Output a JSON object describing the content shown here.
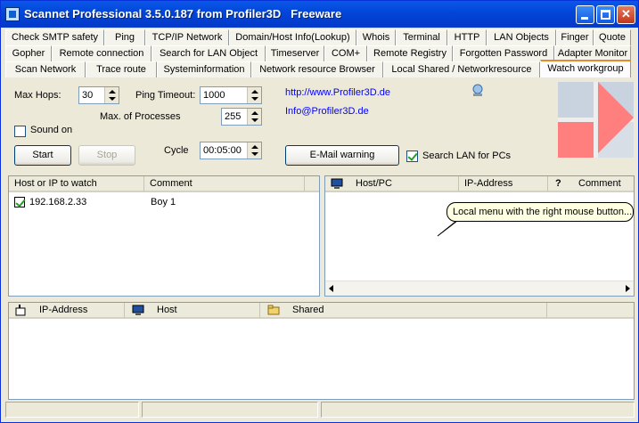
{
  "window": {
    "title": "Scannet Professional 3.5.0.187 from Profiler3D   Freeware"
  },
  "tabs": {
    "row1": [
      "Check SMTP safety",
      "Ping",
      "TCP/IP Network",
      "Domain/Host Info(Lookup)",
      "Whois",
      "Terminal",
      "HTTP",
      "LAN Objects",
      "Finger",
      "Quote"
    ],
    "row2": [
      "Gopher",
      "Remote connection",
      "Search for LAN Object",
      "Timeserver",
      "COM+",
      "Remote Registry",
      "Forgotten Password",
      "Adapter Monitor"
    ],
    "row3": [
      "Scan Network",
      "Trace route",
      "Systeminformation",
      "Network resource Browser",
      "Local Shared / Networkresource",
      "Watch workgroup"
    ],
    "active": "Watch workgroup"
  },
  "settings": {
    "max_hops_label": "Max Hops:",
    "max_hops_value": "30",
    "ping_timeout_label": "Ping Timeout:",
    "ping_timeout_value": "1000",
    "max_processes_label": "Max. of  Processes",
    "max_processes_value": "255",
    "sound_on_label": "Sound on",
    "sound_on_checked": false,
    "cycle_label": "Cycle",
    "cycle_value": "00:05:00",
    "start_label": "Start",
    "stop_label": "Stop",
    "email_warning_label": "E-Mail warning",
    "search_lan_label": "Search LAN for PCs",
    "search_lan_checked": true,
    "link_web": "http://www.Profiler3D.de",
    "link_mail": "Info@Profiler3D.de"
  },
  "watch_list": {
    "columns": [
      "Host or IP to watch",
      "Comment"
    ],
    "rows": [
      {
        "checked": true,
        "host": "192.168.2.33",
        "comment": "Boy 1"
      }
    ]
  },
  "host_list": {
    "columns": [
      "Host/PC",
      "IP-Address",
      "Comment"
    ],
    "tooltip": "Local menu with the right mouse button..."
  },
  "shares_list": {
    "columns": [
      "IP-Address",
      "Host",
      "Shared"
    ]
  },
  "colors": {
    "titlebar": "#0245D8",
    "tab_active_accent": "#E68B2C",
    "link": "#0000FF",
    "logo_pink": "#FF7F7F",
    "logo_gray": "#C9D3E0"
  }
}
